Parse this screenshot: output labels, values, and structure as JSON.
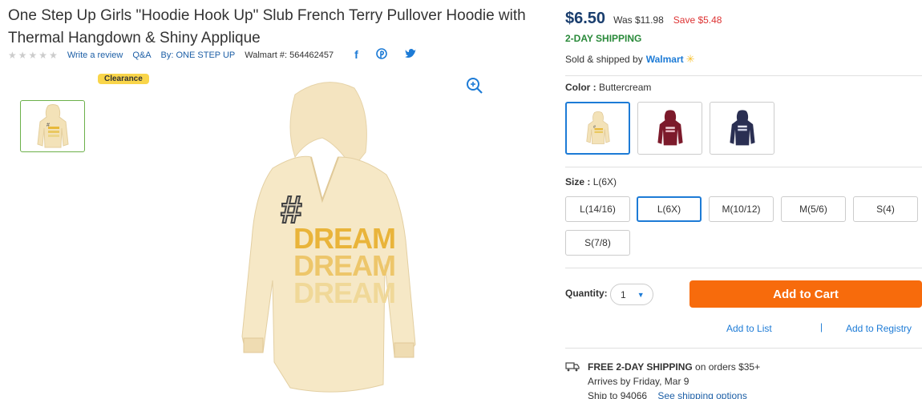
{
  "product": {
    "title": "One Step Up Girls \"Hoodie Hook Up\" Slub French Terry Pullover Hoodie with Thermal Hangdown & Shiny Applique",
    "rating_stars": 5,
    "write_review": "Write a review",
    "qa": "Q&A",
    "by_label": "By: ONE STEP UP",
    "walmart_id": "Walmart #: 564462457",
    "badge": "Clearance"
  },
  "social": {
    "facebook": "f",
    "pinterest": "p",
    "twitter": "t"
  },
  "pricing": {
    "price": "$6.50",
    "was": "Was $11.98",
    "save": "Save $5.48",
    "shipping": "2-DAY SHIPPING",
    "sold_by": "Sold & shipped by",
    "seller": "Walmart",
    "seller_icon": "spark-icon"
  },
  "color": {
    "label": "Color :",
    "selected": "Buttercream",
    "options": [
      {
        "name": "Buttercream",
        "swatch": "#f3e2b8"
      },
      {
        "name": "Burgundy",
        "swatch": "#7c1a2b"
      },
      {
        "name": "Navy",
        "swatch": "#2a2f52"
      }
    ]
  },
  "size": {
    "label": "Size :",
    "selected": "L(6X)",
    "options": [
      "L(14/16)",
      "L(6X)",
      "M(10/12)",
      "M(5/6)",
      "S(4)",
      "S(7/8)"
    ]
  },
  "purchase": {
    "quantity_label": "Quantity:",
    "quantity": "1",
    "add_to_cart": "Add to Cart",
    "add_to_list": "Add to List",
    "separator": "|",
    "add_to_registry": "Add to Registry"
  },
  "delivery": {
    "free_label": "FREE 2-DAY SHIPPING",
    "free_suffix": " on orders $35+",
    "arrives": "Arrives by Friday, Mar 9",
    "ship_to": "Ship to 94066",
    "see_options": "See shipping options"
  },
  "colors": {
    "accent": "#1d7bd6",
    "cart": "#f76b0c",
    "ship_green": "#2a8a3a",
    "save_red": "#d33333",
    "badge": "#f9d54a"
  }
}
